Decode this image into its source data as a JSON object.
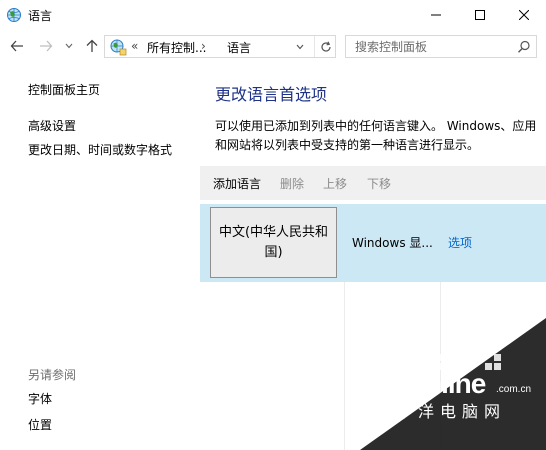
{
  "window": {
    "title": "语言"
  },
  "nav": {
    "address": {
      "overflow": "«",
      "segments": [
        "所有控制...",
        "语言"
      ],
      "separator": "›"
    },
    "search": {
      "placeholder": "搜索控制面板"
    }
  },
  "sidebar": {
    "home": "控制面板主页",
    "advanced": "高级设置",
    "datetime": "更改日期、时间或数字格式",
    "see_also_heading": "另请参阅",
    "see_also": [
      "字体",
      "位置"
    ]
  },
  "main": {
    "title": "更改语言首选项",
    "description": "可以使用已添加到列表中的任何语言键入。 Windows、应用和网站将以列表中受支持的第一种语言进行显示。",
    "toolbar": {
      "add": "添加语言",
      "remove": "删除",
      "up": "上移",
      "down": "下移"
    },
    "languages": [
      {
        "name": "中文(中华人民共和国)",
        "status": "Windows 显...",
        "options": "选项"
      }
    ]
  },
  "watermark": {
    "brand": "PConline",
    "domain": ".com.cn",
    "slogan": "太平洋电脑网"
  },
  "colors": {
    "title_blue": "#1e3287",
    "link_blue": "#0066cc",
    "selected_row": "#cce8f5",
    "toolbar_bg": "#f0f0f0"
  }
}
